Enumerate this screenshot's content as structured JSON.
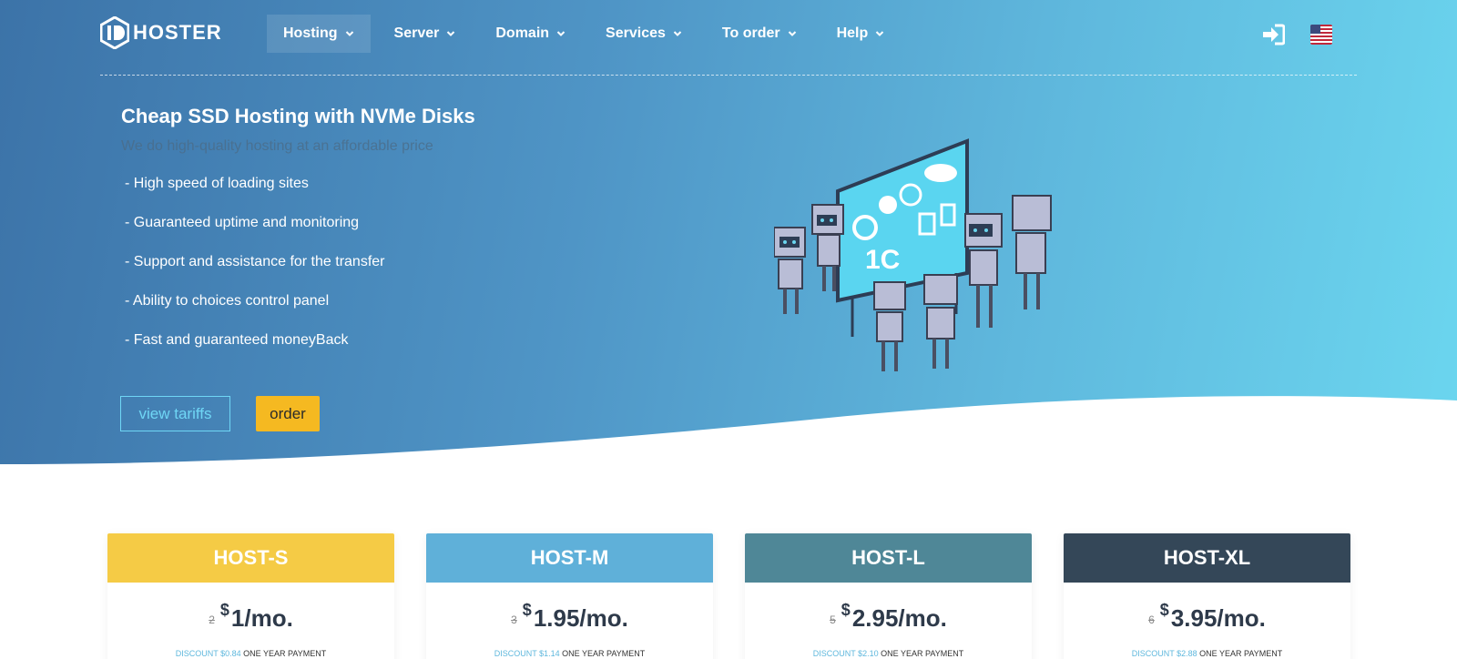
{
  "nav": {
    "logo_text": "HOSTER",
    "items": [
      {
        "label": "Hosting",
        "active": true
      },
      {
        "label": "Server",
        "active": false
      },
      {
        "label": "Domain",
        "active": false
      },
      {
        "label": "Services",
        "active": false
      },
      {
        "label": "To order",
        "active": false
      },
      {
        "label": "Help",
        "active": false
      }
    ],
    "login_icon": "sign-in-icon",
    "language_icon": "us-flag-icon"
  },
  "hero": {
    "title": "Cheap SSD Hosting with NVMe Disks",
    "subtitle": "We do high-quality hosting at an affordable price",
    "features": [
      "- High speed of loading sites",
      "- Guaranteed uptime and monitoring",
      "- Support and assistance for the transfer",
      "- Ability to choices control panel",
      "- Fast and guaranteed moneyBack"
    ],
    "view_tariffs_label": "view tariffs",
    "order_label": "order"
  },
  "plans": [
    {
      "name": "HOST-S",
      "old_price": "2",
      "currency": "$",
      "price": "1",
      "period": "/mo.",
      "color": "#f5cb45",
      "discount": "DISCOUNT $0.84",
      "note": "ONE YEAR PAYMENT"
    },
    {
      "name": "HOST-M",
      "old_price": "3",
      "currency": "$",
      "price": "1.95",
      "period": "/mo.",
      "color": "#5fb0d9",
      "discount": "DISCOUNT $1.14",
      "note": "ONE YEAR PAYMENT"
    },
    {
      "name": "HOST-L",
      "old_price": "5",
      "currency": "$",
      "price": "2.95",
      "period": "/mo.",
      "color": "#4f8797",
      "discount": "DISCOUNT $2.10",
      "note": "ONE YEAR PAYMENT"
    },
    {
      "name": "HOST-XL",
      "old_price": "6",
      "currency": "$",
      "price": "3.95",
      "period": "/mo.",
      "color": "#344758",
      "discount": "DISCOUNT $2.88",
      "note": "ONE YEAR PAYMENT"
    }
  ]
}
